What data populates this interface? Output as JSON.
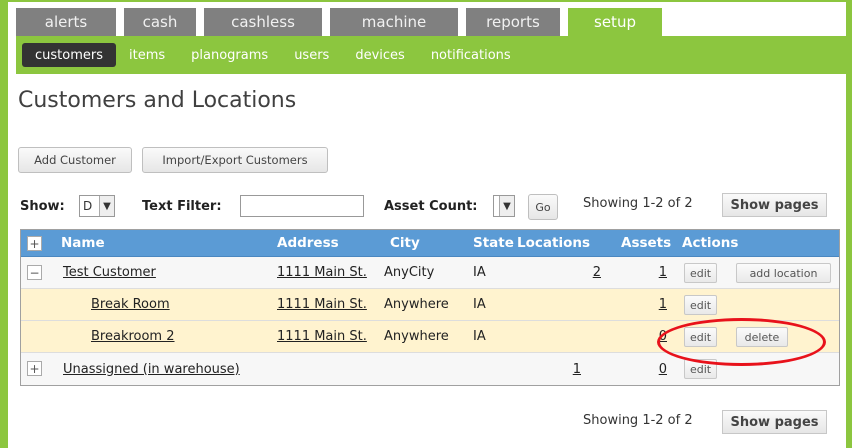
{
  "top_tabs": [
    "alerts",
    "cash",
    "cashless",
    "machine",
    "reports",
    "setup"
  ],
  "active_top_tab": "setup",
  "sub_nav": [
    "customers",
    "items",
    "planograms",
    "users",
    "devices",
    "notifications"
  ],
  "active_sub_nav": "customers",
  "page_title": "Customers and Locations",
  "buttons": {
    "add_customer": "Add Customer",
    "import_export": "Import/Export Customers",
    "go": "Go",
    "show_pages": "Show pages"
  },
  "filters": {
    "show_label": "Show:",
    "show_value": "D",
    "text_filter_label": "Text Filter:",
    "text_filter_value": "",
    "asset_count_label": "Asset Count:",
    "asset_count_value": ""
  },
  "showing_text": "Showing 1-2 of 2",
  "table": {
    "columns": [
      "Name",
      "Address",
      "City",
      "State",
      "Locations",
      "Assets",
      "Actions"
    ],
    "rows": [
      {
        "toggle": "−",
        "name": "Test Customer",
        "address": "1111 Main St.",
        "city": "AnyCity",
        "state": "IA",
        "locations": "2",
        "assets": "1",
        "actions": [
          "edit",
          "add location"
        ]
      },
      {
        "toggle": "",
        "name": "Break Room",
        "address": "1111 Main St.",
        "city": "Anywhere",
        "state": "IA",
        "locations": "",
        "assets": "1",
        "actions": [
          "edit"
        ]
      },
      {
        "toggle": "",
        "name": "Breakroom 2",
        "address": "1111 Main St.",
        "city": "Anywhere",
        "state": "IA",
        "locations": "",
        "assets": "0",
        "actions": [
          "edit",
          "delete"
        ]
      },
      {
        "toggle": "+",
        "name": "Unassigned (in warehouse)",
        "address": "",
        "city": "",
        "state": "",
        "locations": "1",
        "assets": "0",
        "actions": [
          "edit"
        ]
      }
    ],
    "header_toggle": "+"
  },
  "colors": {
    "brand_green": "#8cc63f",
    "header_blue": "#5b9bd5",
    "location_row": "#fff3cf",
    "highlight_red": "#e8121b"
  }
}
